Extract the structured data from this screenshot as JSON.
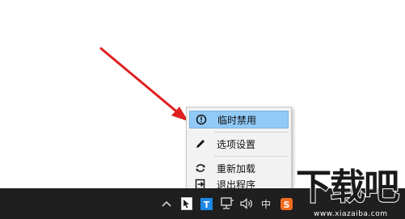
{
  "context_menu": {
    "items": [
      {
        "label": "临时禁用",
        "icon": "info-circle-icon",
        "highlighted": true
      },
      {
        "label": "选项设置",
        "icon": "pencil-icon",
        "highlighted": false
      },
      {
        "label": "重新加载",
        "icon": "refresh-icon",
        "highlighted": false
      },
      {
        "label": "退出程序",
        "icon": "exit-icon",
        "highlighted": false
      }
    ]
  },
  "taskbar": {
    "ime_label": "中",
    "tray_icons": [
      "chevron-up-icon",
      "app-tray-icon",
      "typora-tray-icon",
      "network-icon",
      "volume-icon",
      "ime-icon",
      "sogou-icon"
    ]
  },
  "watermark": {
    "title": "下载吧",
    "url": "www.xiazaiba.com"
  },
  "colors": {
    "menu_highlight": "#91c9f7",
    "taskbar": "#1f1f1f",
    "arrow": "#e02020",
    "tray_blue": "#1e88e5",
    "sogou_orange": "#f26c1f"
  }
}
